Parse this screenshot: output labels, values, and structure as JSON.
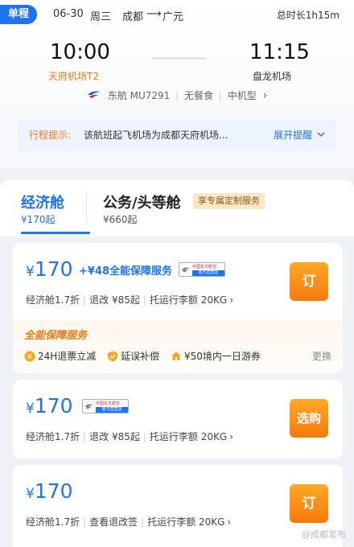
{
  "trip": {
    "tag": "单程",
    "date": "06-30",
    "weekday": "周三",
    "from": "成都",
    "arrow": "⟶",
    "to": "广元",
    "duration": "总时长1h15m"
  },
  "flight": {
    "dep_time": "10:00",
    "arr_time": "11:15",
    "dep_airport": "天府机场T2",
    "arr_airport": "盘龙机场",
    "airline": "东航 MU7291",
    "meal": "无餐食",
    "aircraft": "中机型",
    "chevron": "›"
  },
  "tip": {
    "label": "行程提示:",
    "text": "该航班起飞机场为成都天府机场...",
    "more": "展开提醒"
  },
  "tabs": {
    "economy": {
      "name": "经济舱",
      "price": "¥170起"
    },
    "business": {
      "name": "公务/头等舱",
      "price": "¥660起",
      "badge": "享专属定制服务"
    }
  },
  "fares": [
    {
      "price": "170",
      "currency": "¥",
      "addon": "+¥48全能保障服务",
      "badge_top": "中国东方航空",
      "badge_bottom": "官方直营店",
      "discount": "经济舱1.7折",
      "change": "退改 ¥85起",
      "baggage": "托运行李额 20KG",
      "button": "订"
    },
    {
      "price": "170",
      "currency": "¥",
      "badge_top": "中国东方航空",
      "badge_bottom": "官方直营店",
      "discount": "经济舱1.7折",
      "change": "退改 ¥85起",
      "baggage": "托运行李额 20KG",
      "button": "选购"
    },
    {
      "price": "170",
      "currency": "¥",
      "discount": "经济舱1.7折",
      "change": "查看退改签",
      "baggage": "托运行李额 20KG",
      "button": "订"
    }
  ],
  "plan": {
    "title": "全能保障服务",
    "items": [
      "24H退票立减",
      "延误补偿",
      "¥50境内一日游券"
    ],
    "change": "更换"
  },
  "watermark": "@成都发布",
  "colors": {
    "primary": "#1f73f1",
    "orange": "#f57a0e",
    "accent_text": "#f07a12"
  }
}
